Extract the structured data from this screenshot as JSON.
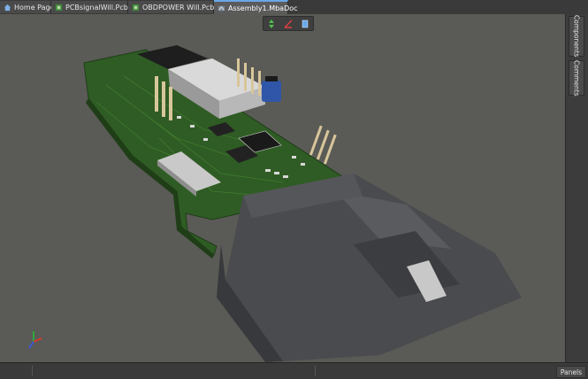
{
  "tabs": [
    {
      "label": "Home Page",
      "icon": "home-icon",
      "active": false
    },
    {
      "label": "PCBsignalWill.PcbDoc",
      "icon": "pcb-doc-icon",
      "active": false
    },
    {
      "label": "OBDPOWER Will.PcbDoc",
      "icon": "pcb-doc-icon",
      "active": false
    },
    {
      "label": "Assembly1.MbaDoc",
      "icon": "assembly-doc-icon",
      "active": true
    }
  ],
  "toolbar": {
    "buttons": [
      {
        "icon": "explode-icon"
      },
      {
        "icon": "measure-icon"
      },
      {
        "icon": "section-view-icon"
      }
    ]
  },
  "right_panel": {
    "tabs": [
      "Components",
      "Comments"
    ]
  },
  "statusbar": {
    "panels_label": "Panels"
  },
  "colors": {
    "viewport_bg": "#5a5a56",
    "pcb_green": "#2e5a22",
    "connector_gray": "#4a4b4e",
    "accent": "#6aa8e8"
  }
}
